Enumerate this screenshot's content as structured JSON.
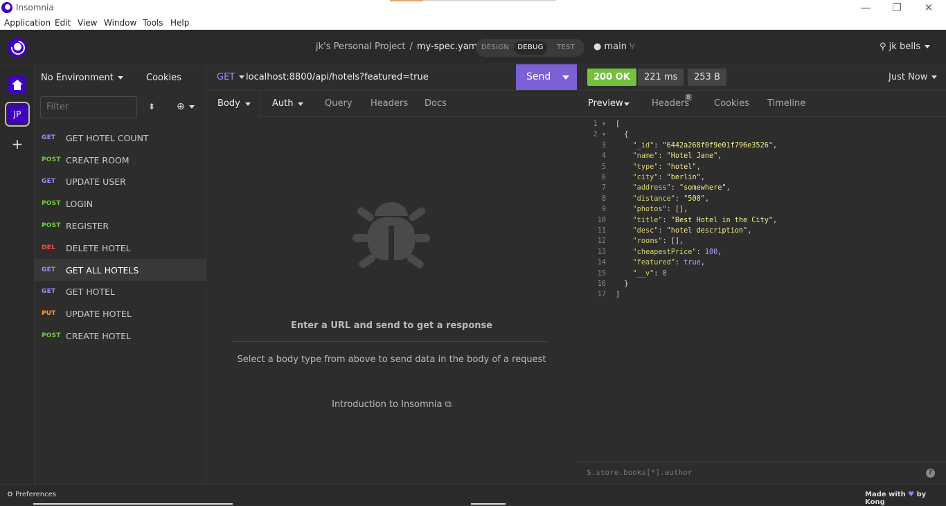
{
  "window": {
    "title": "Insomnia",
    "controls": {
      "minimize": "—",
      "restore": "❐",
      "close": "✕"
    }
  },
  "menu": [
    "Application",
    "Edit",
    "View",
    "Window",
    "Tools",
    "Help"
  ],
  "topbar": {
    "project": "jk's Personal Project",
    "separator": "/",
    "spec": "my-spec.yaml",
    "modes": [
      "DESIGN",
      "DEBUG",
      "TEST"
    ],
    "active_mode": "DEBUG",
    "branch": "main",
    "user": "jk bells"
  },
  "rail": {
    "workspace_initials": "JP",
    "add": "+"
  },
  "sidebar": {
    "environment": "No Environment",
    "cookies": "Cookies",
    "filter_placeholder": "Filter",
    "requests": [
      {
        "method": "GET",
        "name": "GET HOTEL COUNT",
        "selected": false
      },
      {
        "method": "POST",
        "name": "CREATE ROOM",
        "selected": false
      },
      {
        "method": "GET",
        "name": "UPDATE USER",
        "selected": false
      },
      {
        "method": "POST",
        "name": "LOGIN",
        "selected": false
      },
      {
        "method": "POST",
        "name": "REGISTER",
        "selected": false
      },
      {
        "method": "DEL",
        "name": "DELETE HOTEL",
        "selected": false
      },
      {
        "method": "GET",
        "name": "GET ALL HOTELS",
        "selected": true
      },
      {
        "method": "GET",
        "name": "GET HOTEL",
        "selected": false
      },
      {
        "method": "PUT",
        "name": "UPDATE HOTEL",
        "selected": false
      },
      {
        "method": "POST",
        "name": "CREATE HOTEL",
        "selected": false
      }
    ]
  },
  "request": {
    "method": "GET",
    "url": "localhost:8800/api/hotels?featured=true",
    "send": "Send",
    "tabs": [
      "Body",
      "Auth",
      "Query",
      "Headers",
      "Docs"
    ],
    "empty_title": "Enter a URL and send to get a response",
    "body_hint": "Select a body type from above to send data in the body of a request",
    "intro_link": "Introduction to Insomnia"
  },
  "response": {
    "status": "200 OK",
    "time": "221 ms",
    "size": "253 B",
    "when": "Just Now",
    "tabs": [
      "Preview",
      "Headers",
      "Cookies",
      "Timeline"
    ],
    "headers_count": "8",
    "filter_placeholder": "$.store.books[*].author",
    "help": "?"
  },
  "json_lines": [
    "[",
    "  {",
    "    \"_id\": \"6442a268f0f9e01f796e3526\",",
    "    \"name\": \"Hotel Jane\",",
    "    \"type\": \"hotel\",",
    "    \"city\": \"berlin\",",
    "    \"address\": \"somewhere\",",
    "    \"distance\": \"500\",",
    "    \"photos\": [],",
    "    \"title\": \"Best Hotel in the City\",",
    "    \"desc\": \"hotel description\",",
    "    \"rooms\": [],",
    "    \"cheapestPrice\": 100,",
    "    \"featured\": true,",
    "    \"__v\": 0",
    "  }",
    "]"
  ],
  "status_bar": {
    "preferences": "Preferences",
    "made_with": "Made with",
    "heart": "♥",
    "by": "by Kong"
  },
  "colors": {
    "accent": "#4000bf",
    "send": "#7b60d6",
    "ok": "#73c13c",
    "get": "#a28bff",
    "post": "#73c940",
    "delete": "#ff4d4d",
    "put": "#ff9a3c"
  }
}
